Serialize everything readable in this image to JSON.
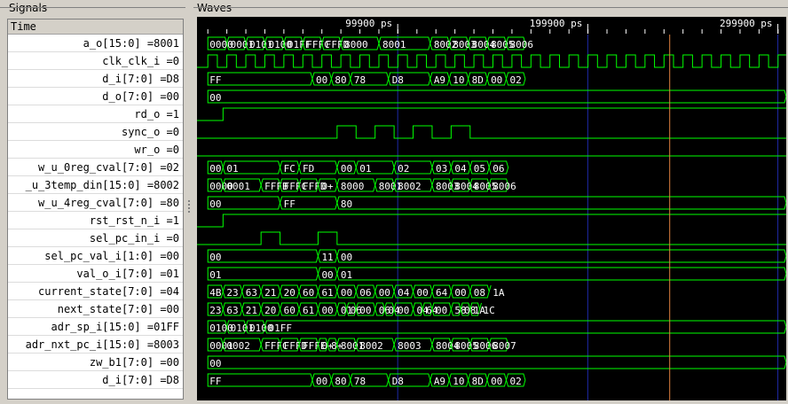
{
  "panels": {
    "signals": "Signals",
    "waves": "Waves"
  },
  "time_header": "Time",
  "timeline": {
    "start": -5700,
    "end": 304300,
    "major_ticks": [
      99900,
      199900,
      299900
    ],
    "unit": "ps",
    "cursor": 243000
  },
  "colors": {
    "bg": "#000000",
    "wave": "#00ff00",
    "text": "#ffffff",
    "grid": "#1e2aa6",
    "cursor": "#e08040"
  },
  "signals": [
    {
      "label": "a_o[15:0] =8001",
      "type": "bus",
      "t": [
        0,
        10000,
        20000,
        30000,
        40000,
        50000,
        60000,
        70000,
        90000,
        117000,
        127000,
        137000,
        147000,
        157000,
        167000
      ],
      "v": [
        "0000",
        "0001",
        "0101",
        "0100",
        "01FF",
        "FFFC",
        "FFFD",
        "8000",
        "8001",
        "8002",
        "8003",
        "8004",
        "8005",
        "8006"
      ]
    },
    {
      "label": "clk_clk_i =0",
      "type": "clock",
      "period": 10000
    },
    {
      "label": "d_i[7:0] =D8",
      "type": "bus",
      "t": [
        0,
        55000,
        65000,
        75000,
        95000,
        117000,
        127000,
        137000,
        147000,
        157000,
        167000
      ],
      "v": [
        "FF",
        "00",
        "80",
        "78",
        "D8",
        "A9",
        "10",
        "8D",
        "00",
        "02"
      ]
    },
    {
      "label": "d_o[7:0] =00",
      "type": "bus",
      "t": [
        0,
        304300
      ],
      "v": [
        "00"
      ]
    },
    {
      "label": "rd_o =1",
      "type": "bit",
      "init": 0,
      "edges": [
        8000
      ]
    },
    {
      "label": "sync_o =0",
      "type": "bit",
      "init": 0,
      "edges": [
        68000,
        78000,
        88000,
        98000,
        108000,
        118000,
        128000,
        138000
      ]
    },
    {
      "label": "wr_o =0",
      "type": "bit",
      "init": 0,
      "edges": []
    },
    {
      "label": "w_u_0reg_cval[7:0] =02",
      "type": "bus",
      "t": [
        0,
        8000,
        38000,
        48000,
        68000,
        78000,
        98000,
        118000,
        128000,
        138000,
        148000,
        158000
      ],
      "v": [
        "00",
        "01",
        "FC",
        "FD",
        "00",
        "01",
        "02",
        "03",
        "04",
        "05",
        "06"
      ]
    },
    {
      "label": "_u_3temp_din[15:0] =8002",
      "type": "bus",
      "t": [
        0,
        8000,
        28000,
        38000,
        48000,
        58000,
        68000,
        88000,
        98000,
        118000,
        128000,
        138000,
        148000,
        158000
      ],
      "v": [
        "0000",
        "0001",
        "FFFB",
        "FFFC",
        "FFFD",
        "0+",
        "8000",
        "8001",
        "8002",
        "8003",
        "8004",
        "8005",
        "8006"
      ]
    },
    {
      "label": "w_u_4reg_cval[7:0] =80",
      "type": "bus",
      "t": [
        0,
        38000,
        68000,
        304300
      ],
      "v": [
        "00",
        "FF",
        "80"
      ]
    },
    {
      "label": "rst_rst_n_i =1",
      "type": "bit",
      "init": 0,
      "edges": [
        8000
      ]
    },
    {
      "label": "sel_pc_in_i =0",
      "type": "bit",
      "init": 0,
      "edges": [
        28000,
        38000,
        58000,
        68000
      ]
    },
    {
      "label": "sel_pc_val_i[1:0] =00",
      "type": "bus",
      "t": [
        0,
        58000,
        68000,
        304300
      ],
      "v": [
        "00",
        "11",
        "00"
      ]
    },
    {
      "label": "val_o_i[7:0] =01",
      "type": "bus",
      "t": [
        0,
        58000,
        68000,
        304300
      ],
      "v": [
        "01",
        "00",
        "01"
      ]
    },
    {
      "label": "current_state[7:0] =04",
      "type": "bus",
      "t": [
        0,
        8000,
        18000,
        28000,
        38000,
        48000,
        58000,
        68000,
        78000,
        88000,
        98000,
        108000,
        118000,
        128000,
        138000,
        148000
      ],
      "v": [
        "4B",
        "23",
        "63",
        "21",
        "20",
        "60",
        "61",
        "00",
        "06",
        "00",
        "04",
        "00",
        "64",
        "00",
        "08",
        "1A"
      ]
    },
    {
      "label": "next_state[7:0] =00",
      "type": "bus",
      "t": [
        0,
        8000,
        18000,
        28000,
        38000,
        48000,
        58000,
        68000,
        73000,
        78000,
        88000,
        93000,
        98000,
        108000,
        113000,
        118000,
        128000,
        133000,
        138000,
        143000
      ],
      "v": [
        "23",
        "63",
        "21",
        "20",
        "60",
        "61",
        "00",
        "01",
        "06",
        "00",
        "06",
        "04",
        "00",
        "04",
        "64",
        "00",
        "58",
        "08",
        "1A",
        "1C"
      ]
    },
    {
      "label": "adr_sp_i[15:0] =01FF",
      "type": "bus",
      "t": [
        0,
        10000,
        20000,
        30000,
        304300
      ],
      "v": [
        "0100",
        "0101",
        "0100",
        "01FF"
      ]
    },
    {
      "label": "adr_nxt_pc_i[15:0] =8003",
      "type": "bus",
      "t": [
        0,
        8000,
        28000,
        38000,
        48000,
        58000,
        63000,
        68000,
        78000,
        98000,
        118000,
        128000,
        138000,
        148000,
        158000
      ],
      "v": [
        "0001",
        "0002",
        "FFFC",
        "FFFD",
        "FFFE",
        "0+",
        "8+",
        "8001",
        "8002",
        "8003",
        "8004",
        "8005",
        "8006",
        "8007"
      ]
    },
    {
      "label": "zw_b1[7:0] =00",
      "type": "bus",
      "t": [
        0,
        304300
      ],
      "v": [
        "00"
      ]
    },
    {
      "label": "d_i[7:0] =D8",
      "type": "bus",
      "t": [
        0,
        55000,
        65000,
        75000,
        95000,
        117000,
        127000,
        137000,
        147000,
        157000,
        167000
      ],
      "v": [
        "FF",
        "00",
        "80",
        "78",
        "D8",
        "A9",
        "10",
        "8D",
        "00",
        "02"
      ]
    }
  ]
}
